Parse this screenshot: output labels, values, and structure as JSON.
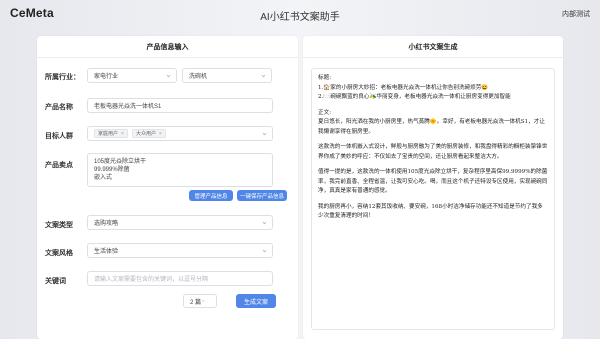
{
  "brand": {
    "logo": "CeMeta"
  },
  "header": {
    "title": "AI小红书文案助手",
    "account_label": "内部测试"
  },
  "left_panel": {
    "title": "产品信息输入",
    "industry": {
      "label": "所属行业：",
      "value1": "家电行业",
      "value2": "洗碗机"
    },
    "product_name": {
      "label": "产品名称",
      "value": "老板电器光焱洗一体机S1"
    },
    "target_audience": {
      "label": "目标人群",
      "tags": [
        "家庭用户",
        "大众用户"
      ]
    },
    "selling_points": {
      "label": "产品卖点",
      "lines": [
        "105度光焱除立烘干",
        "99.999%除菌",
        "嵌入式"
      ]
    },
    "buttons": {
      "manage": "管理产品信息",
      "save": "一键保存产品信息"
    },
    "copy_type": {
      "label": "文案类型",
      "value": "选购攻略"
    },
    "copy_style": {
      "label": "文案风格",
      "value": "生活体验"
    },
    "keywords": {
      "label": "关键词",
      "placeholder": "请输入文案需要包含的关键词，以逗号分隔"
    },
    "count": {
      "value": "2 篇"
    },
    "generate": {
      "label": "生成文案"
    }
  },
  "right_panel": {
    "title": "小红书文案生成",
    "output_lines": [
      "标题:",
      "1.🏠家的小厨房大妙招：老板电器光焱洗一体机让你告别洗碗烦劳😆",
      "2.🍽️碗碗飘蓝的良心🫒华丽变身，老板电器光焱洗一体机让厨房变得更加智能",
      "",
      "正文:",
      "夏日悠长，阳光洒在我的小厨房里，热气蒸腾🌞。幸好，有老板电器光焱洗一体机S1，才让我懒谢享得在厨房里。",
      "",
      "这款洗的一体机嵌入式设计，鲜般与厨房融为了美的厨房装修，和我盘得精彩的橱柜装挚锋世界你成了美妙的呼应：不仅如去了宝贵的空间，还让厨房看起来整洁大方。",
      "",
      "值得一提的是，这款洗的一体机使用105度光焱除立烘干，复杂程序里高保99.9999%的除菌率，我完前直香、全程省温，让我可安心吃。喝，而且这个机子还特设专区使用，实现碗碗同净，真真是家有普通的感觉。",
      "",
      "我的厨房再小，容纳12套其饭收纳、要安碗，168小时洁净储存功能还不知道是节约了我多少次重复清理的时间！"
    ]
  }
}
